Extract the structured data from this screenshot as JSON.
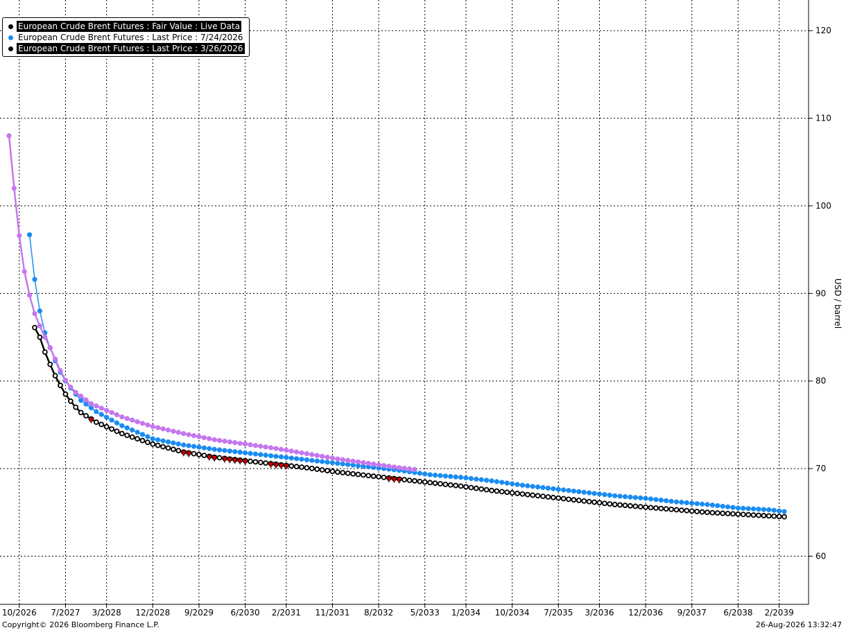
{
  "chart_data": {
    "type": "line",
    "ylabel": "USD / barrel",
    "ylim": [
      54.5,
      123.5
    ],
    "yticks": [
      60,
      70,
      80,
      90,
      100,
      110,
      120
    ],
    "x_axis": {
      "tick_labels": [
        "10/2026",
        "7/2027",
        "3/2028",
        "12/2028",
        "9/2029",
        "6/2030",
        "2/2031",
        "11/2031",
        "8/2032",
        "5/2033",
        "1/2034",
        "10/2034",
        "7/2035",
        "3/2036",
        "12/2036",
        "9/2037",
        "6/2038",
        "2/2039"
      ],
      "range": [
        "8/2026",
        "4/2039"
      ]
    },
    "grid": true,
    "grid_style": "dotted",
    "legend_position": "top-left",
    "series": [
      {
        "name": "European Crude Brent Futures : Fair Value : Live Data",
        "color": "#c577ee",
        "marker": "filled-circle",
        "start": "8/2026",
        "end": "3/2033",
        "points": [
          [
            "8/2026",
            108
          ],
          [
            "9/2026",
            102
          ],
          [
            "10/2026",
            96.6
          ],
          [
            "11/2026",
            92.5
          ],
          [
            "12/2026",
            89.8
          ],
          [
            "1/2027",
            87.7
          ],
          [
            "2/2027",
            86.3
          ],
          [
            "3/2027",
            85.0
          ],
          [
            "4/2027",
            83.8
          ],
          [
            "5/2027",
            82.5
          ],
          [
            "6/2027",
            81.2
          ],
          [
            "7/2027",
            80.1
          ],
          [
            "8/2027",
            79.3
          ],
          [
            "9/2027",
            78.7
          ],
          [
            "12/2027",
            77.4
          ],
          [
            "6/2028",
            75.9
          ],
          [
            "12/2028",
            74.8
          ],
          [
            "6/2029",
            74.0
          ],
          [
            "12/2029",
            73.3
          ],
          [
            "6/2030",
            72.8
          ],
          [
            "12/2030",
            72.3
          ],
          [
            "6/2031",
            71.7
          ],
          [
            "12/2031",
            71.1
          ],
          [
            "6/2032",
            70.6
          ],
          [
            "12/2032",
            70.1
          ],
          [
            "3/2033",
            69.9
          ]
        ]
      },
      {
        "name": "European Crude Brent Futures : Last Price : 7/24/2026",
        "color": "#1a8cf0",
        "marker": "filled-circle",
        "start": "12/2026",
        "end": "3/2039",
        "points": [
          [
            "12/2026",
            96.7
          ],
          [
            "1/2027",
            91.6
          ],
          [
            "2/2027",
            88.0
          ],
          [
            "3/2027",
            85.5
          ],
          [
            "4/2027",
            83.8
          ],
          [
            "5/2027",
            82.3
          ],
          [
            "6/2027",
            81.0
          ],
          [
            "7/2027",
            80.0
          ],
          [
            "8/2027",
            79.2
          ],
          [
            "10/2027",
            77.8
          ],
          [
            "1/2028",
            76.5
          ],
          [
            "6/2028",
            74.9
          ],
          [
            "12/2028",
            73.4
          ],
          [
            "6/2029",
            72.7
          ],
          [
            "12/2029",
            72.2
          ],
          [
            "6/2030",
            71.8
          ],
          [
            "12/2030",
            71.4
          ],
          [
            "6/2031",
            71.0
          ],
          [
            "12/2031",
            70.6
          ],
          [
            "6/2032",
            70.2
          ],
          [
            "12/2032",
            69.8
          ],
          [
            "6/2033",
            69.3
          ],
          [
            "12/2033",
            69.0
          ],
          [
            "6/2034",
            68.6
          ],
          [
            "12/2034",
            68.1
          ],
          [
            "6/2035",
            67.7
          ],
          [
            "12/2035",
            67.3
          ],
          [
            "6/2036",
            66.9
          ],
          [
            "12/2036",
            66.6
          ],
          [
            "6/2037",
            66.2
          ],
          [
            "12/2037",
            65.9
          ],
          [
            "6/2038",
            65.5
          ],
          [
            "12/2038",
            65.3
          ],
          [
            "3/2039",
            65.1
          ]
        ]
      },
      {
        "name": "European Crude Brent Futures : Last Price : 3/26/2026",
        "color": "#000000",
        "marker": "hollow-circle",
        "start": "1/2027",
        "end": "3/2039",
        "points": [
          [
            "1/2027",
            86.1
          ],
          [
            "2/2027",
            85.0
          ],
          [
            "3/2027",
            83.3
          ],
          [
            "4/2027",
            81.9
          ],
          [
            "5/2027",
            80.6
          ],
          [
            "6/2027",
            79.5
          ],
          [
            "7/2027",
            78.5
          ],
          [
            "8/2027",
            77.7
          ],
          [
            "9/2027",
            77.0
          ],
          [
            "10/2027",
            76.4
          ],
          [
            "1/2028",
            75.3
          ],
          [
            "6/2028",
            74.0
          ],
          [
            "12/2028",
            72.8
          ],
          [
            "6/2029",
            71.9
          ],
          [
            "12/2029",
            71.3
          ],
          [
            "6/2030",
            70.9
          ],
          [
            "12/2030",
            70.5
          ],
          [
            "6/2031",
            70.1
          ],
          [
            "12/2031",
            69.6
          ],
          [
            "6/2032",
            69.2
          ],
          [
            "12/2032",
            68.8
          ],
          [
            "6/2033",
            68.4
          ],
          [
            "12/2033",
            68.0
          ],
          [
            "6/2034",
            67.5
          ],
          [
            "12/2034",
            67.1
          ],
          [
            "6/2035",
            66.7
          ],
          [
            "12/2035",
            66.3
          ],
          [
            "6/2036",
            65.9
          ],
          [
            "12/2036",
            65.6
          ],
          [
            "6/2037",
            65.3
          ],
          [
            "12/2037",
            65.0
          ],
          [
            "6/2038",
            64.8
          ],
          [
            "12/2038",
            64.6
          ],
          [
            "3/2039",
            64.5
          ]
        ]
      }
    ],
    "annotations": {
      "description": "red down-triangle markers on the 3/26/2026 series",
      "color": "#cc0000",
      "dates": [
        "12/2027",
        "6/2029",
        "7/2029",
        "11/2029",
        "12/2029",
        "2/2030",
        "3/2030",
        "4/2030",
        "5/2030",
        "6/2030",
        "11/2030",
        "12/2030",
        "1/2031",
        "2/2031",
        "10/2032",
        "11/2032",
        "12/2032"
      ]
    }
  },
  "footer": {
    "copyright": "Copyright© 2026 Bloomberg Finance L.P.",
    "timestamp": "26-Aug-2026 13:32:47"
  },
  "legend_colors": {
    "dot_fair_value": "#000000",
    "dot_last_price_jul": "#1a8cf0",
    "dot_last_price_mar": "#000000"
  }
}
